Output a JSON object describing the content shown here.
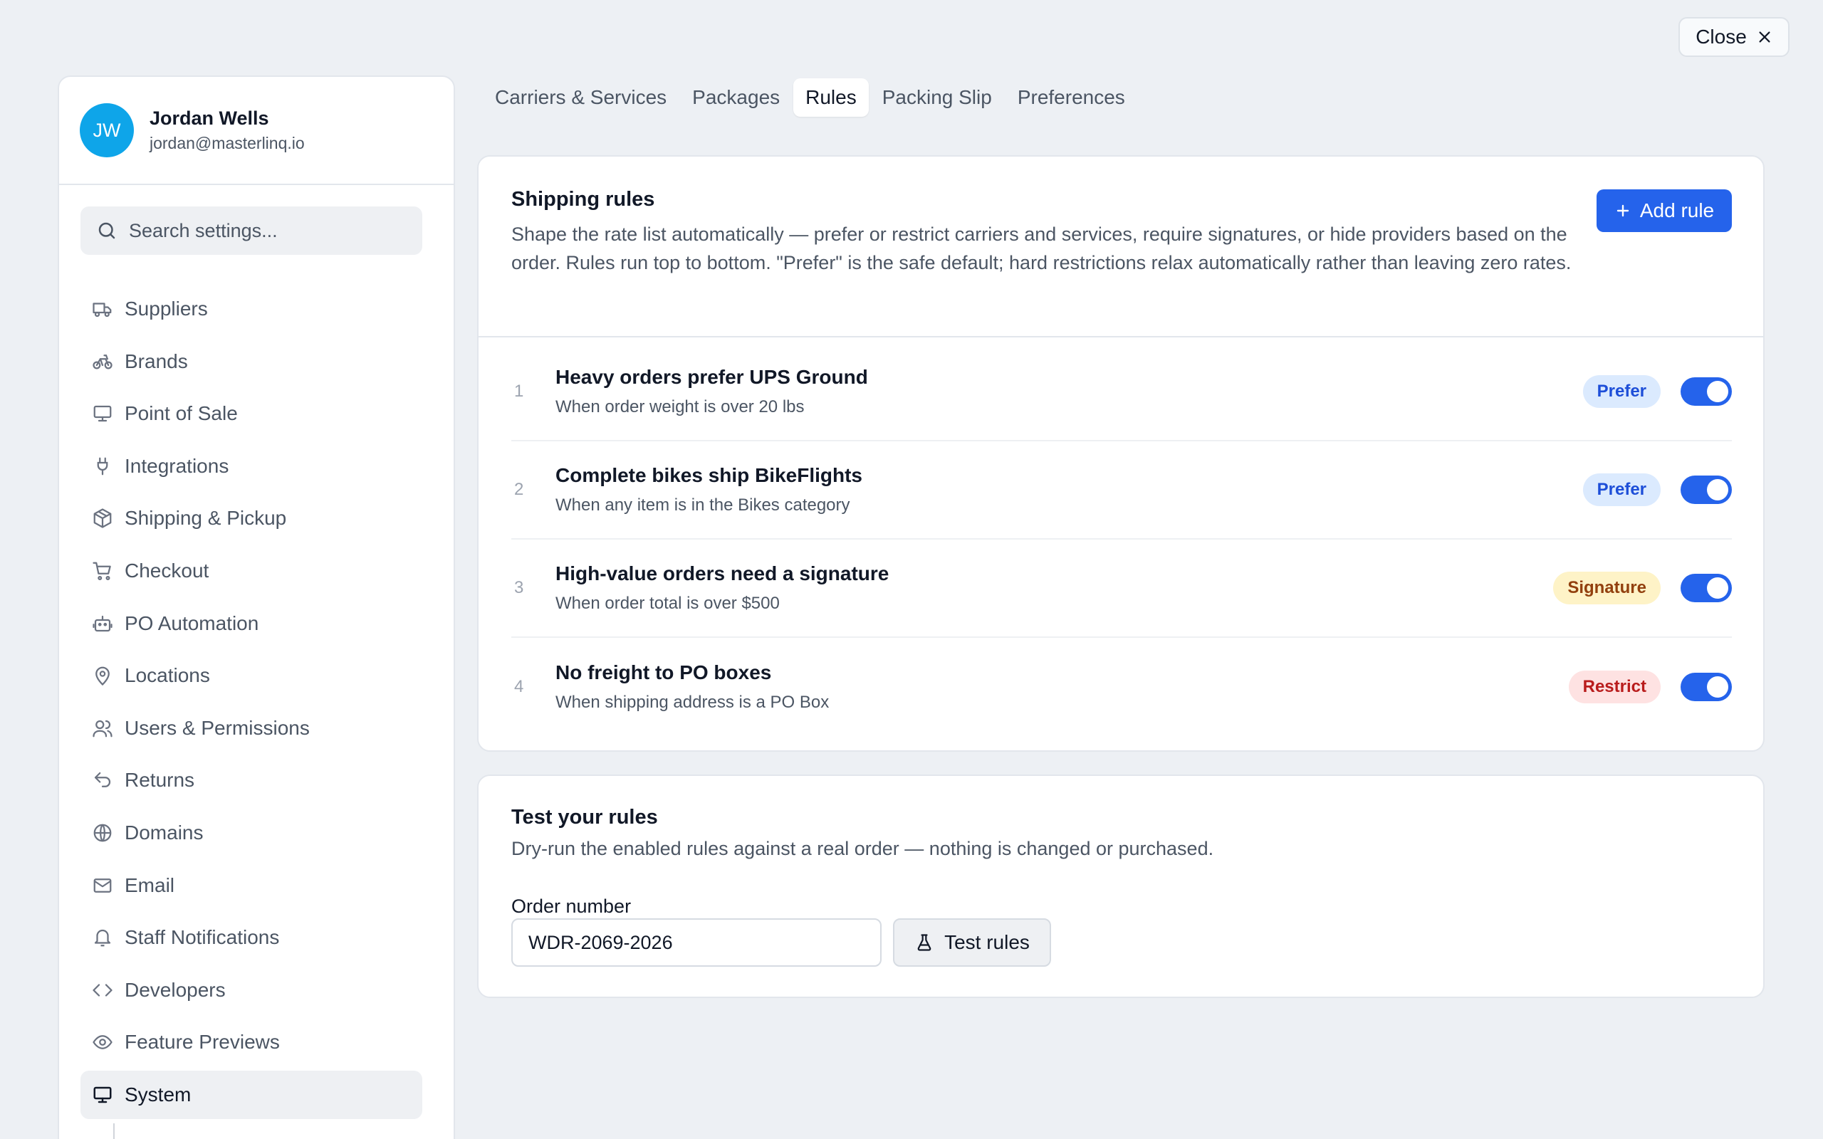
{
  "close_button": {
    "label": "Close",
    "icon": "close-icon"
  },
  "profile": {
    "initials": "JW",
    "name": "Jordan Wells",
    "email": "jordan@masterlinq.io",
    "avatar_color": "#0ea5e9"
  },
  "search": {
    "placeholder": "Search settings..."
  },
  "sidebar": {
    "items": [
      {
        "label": "Suppliers",
        "icon": "truck-icon"
      },
      {
        "label": "Brands",
        "icon": "bicycle-icon"
      },
      {
        "label": "Point of Sale",
        "icon": "monitor-icon"
      },
      {
        "label": "Integrations",
        "icon": "plug-icon"
      },
      {
        "label": "Shipping & Pickup",
        "icon": "package-icon"
      },
      {
        "label": "Checkout",
        "icon": "cart-icon"
      },
      {
        "label": "PO Automation",
        "icon": "robot-icon"
      },
      {
        "label": "Locations",
        "icon": "map-pin-icon"
      },
      {
        "label": "Users & Permissions",
        "icon": "users-icon"
      },
      {
        "label": "Returns",
        "icon": "return-arrow-icon"
      },
      {
        "label": "Domains",
        "icon": "globe-icon"
      },
      {
        "label": "Email",
        "icon": "mail-icon"
      },
      {
        "label": "Staff Notifications",
        "icon": "bell-icon"
      },
      {
        "label": "Developers",
        "icon": "code-icon"
      },
      {
        "label": "Feature Previews",
        "icon": "eye-icon"
      },
      {
        "label": "System",
        "icon": "monitor-icon",
        "active": true
      }
    ]
  },
  "tabs": [
    {
      "label": "Carriers & Services"
    },
    {
      "label": "Packages"
    },
    {
      "label": "Rules",
      "active": true
    },
    {
      "label": "Packing Slip"
    },
    {
      "label": "Preferences"
    }
  ],
  "rules_card": {
    "title": "Shipping rules",
    "description": "Shape the rate list automatically — prefer or restrict carriers and services, require signatures, or hide providers based on the order. Rules run top to bottom. \"Prefer\" is the safe default; hard restrictions relax automatically rather than leaving zero rates.",
    "add_button": "Add rule",
    "accent_color": "#2563eb"
  },
  "rules": [
    {
      "number": "1",
      "title": "Heavy orders prefer UPS Ground",
      "condition": "When order weight is over 20 lbs",
      "badge": "Prefer",
      "badge_bg": "#dbeafe",
      "badge_fg": "#1d4ed8",
      "enabled": true
    },
    {
      "number": "2",
      "title": "Complete bikes ship BikeFlights",
      "condition": "When any item is in the Bikes category",
      "badge": "Prefer",
      "badge_bg": "#dbeafe",
      "badge_fg": "#1d4ed8",
      "enabled": true
    },
    {
      "number": "3",
      "title": "High-value orders need a signature",
      "condition": "When order total is over $500",
      "badge": "Signature",
      "badge_bg": "#fef3c7",
      "badge_fg": "#92400e",
      "enabled": true
    },
    {
      "number": "4",
      "title": "No freight to PO boxes",
      "condition": "When shipping address is a PO Box",
      "badge": "Restrict",
      "badge_bg": "#fee2e2",
      "badge_fg": "#b91c1c",
      "enabled": true
    }
  ],
  "test_card": {
    "title": "Test your rules",
    "description": "Dry-run the enabled rules against a real order — nothing is changed or purchased.",
    "order_label": "Order number",
    "order_value": "WDR-2069-2026",
    "test_button": "Test rules"
  }
}
